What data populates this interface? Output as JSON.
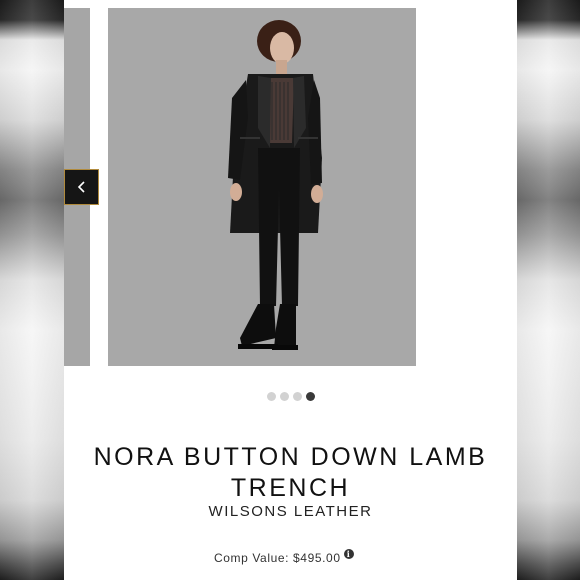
{
  "carousel": {
    "prev_icon": "chevron-left-icon",
    "dot_count": 4,
    "active_dot": 4
  },
  "product": {
    "title": "NORA BUTTON DOWN LAMB TRENCH",
    "brand": "WILSONS LEATHER",
    "comp_value_label": "Comp Value:",
    "comp_value": "$495.00",
    "info_icon": "info-icon"
  },
  "colors": {
    "accent_border": "#b08a3c",
    "nav_bg": "#151515",
    "image_bg": "#a8a8a8"
  }
}
